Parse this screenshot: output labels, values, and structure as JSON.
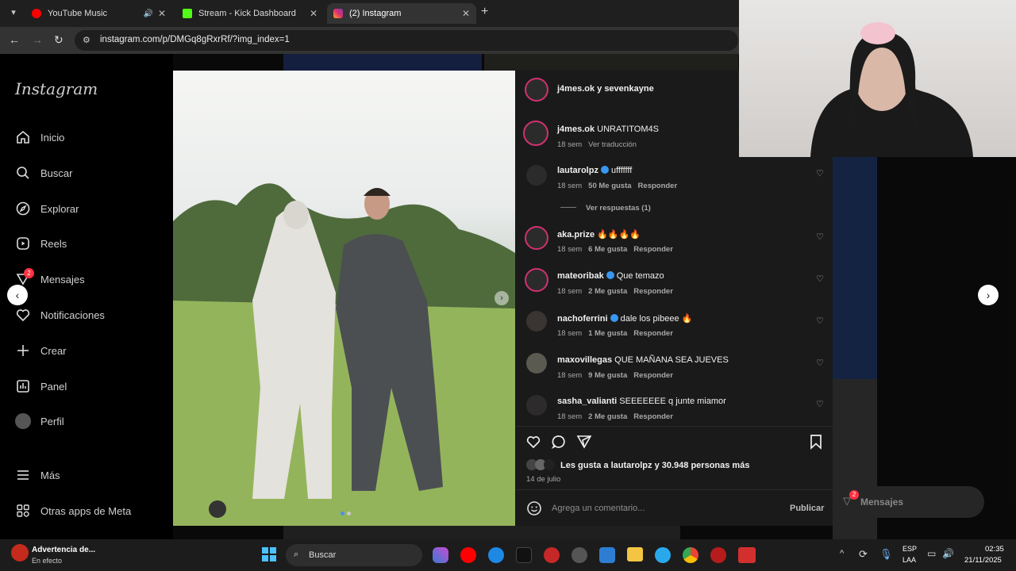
{
  "browser": {
    "tabs": [
      {
        "label": "YouTube Music",
        "color": "#ff0000",
        "audio": true
      },
      {
        "label": "Stream - Kick Dashboard",
        "color": "#53fc18",
        "audio": false
      },
      {
        "label": "(2) Instagram",
        "color": "#e1306c",
        "audio": false
      }
    ],
    "url": "instagram.com/p/DMGq8gRxrRf/?img_index=1"
  },
  "sidebar": {
    "logo": "Instagram",
    "items": [
      {
        "label": "Inicio",
        "icon": "home-icon"
      },
      {
        "label": "Buscar",
        "icon": "search-icon"
      },
      {
        "label": "Explorar",
        "icon": "compass-icon"
      },
      {
        "label": "Reels",
        "icon": "reels-icon"
      },
      {
        "label": "Mensajes",
        "icon": "messenger-icon",
        "badge": "2"
      },
      {
        "label": "Notificaciones",
        "icon": "heart-icon"
      },
      {
        "label": "Crear",
        "icon": "plus-icon"
      },
      {
        "label": "Panel",
        "icon": "dashboard-icon"
      },
      {
        "label": "Perfil",
        "icon": "profile-icon"
      },
      {
        "label": "Más",
        "icon": "menu-icon"
      },
      {
        "label": "Otras apps de Meta",
        "icon": "apps-icon"
      }
    ]
  },
  "post": {
    "header": "j4mes.ok y sevenkayne",
    "caption": {
      "user": "j4mes.ok",
      "text": "UNRATITOM4S",
      "time": "18 sem",
      "translate": "Ver traducción"
    },
    "comments": [
      {
        "user": "lautarolpz",
        "verified": true,
        "text": "ufffffff",
        "time": "18 sem",
        "likes": "50 Me gusta",
        "reply": "Responder",
        "replies": "Ver respuestas (1)"
      },
      {
        "user": "aka.prize",
        "verified": false,
        "text": "🔥🔥🔥🔥",
        "time": "18 sem",
        "likes": "6 Me gusta",
        "reply": "Responder"
      },
      {
        "user": "mateoribak",
        "verified": true,
        "text": "Que temazo",
        "time": "18 sem",
        "likes": "2 Me gusta",
        "reply": "Responder"
      },
      {
        "user": "nachoferrini",
        "verified": true,
        "text": "dale los pibeee 🔥",
        "time": "18 sem",
        "likes": "1 Me gusta",
        "reply": "Responder"
      },
      {
        "user": "maxovillegas",
        "verified": false,
        "text": "QUE MAÑANA SEA JUEVES",
        "time": "18 sem",
        "likes": "9 Me gusta",
        "reply": "Responder"
      },
      {
        "user": "sasha_valianti",
        "verified": false,
        "text": "SEEEEEEE q junte miamor",
        "time": "18 sem",
        "likes": "2 Me gusta",
        "reply": "Responder"
      }
    ],
    "likes_text": "Les gusta a lautarolpz y 30.948 personas más",
    "date": "14 de julio",
    "comment_placeholder": "Agrega un comentario...",
    "publish": "Publicar"
  },
  "messages_float": {
    "label": "Mensajes",
    "badge": "2"
  },
  "taskbar": {
    "notification_title": "Advertencia de...",
    "notification_sub": "En efecto",
    "search": "Buscar",
    "lang_top": "ESP",
    "lang_bottom": "LAA",
    "time": "02:35",
    "date": "21/11/2025"
  }
}
